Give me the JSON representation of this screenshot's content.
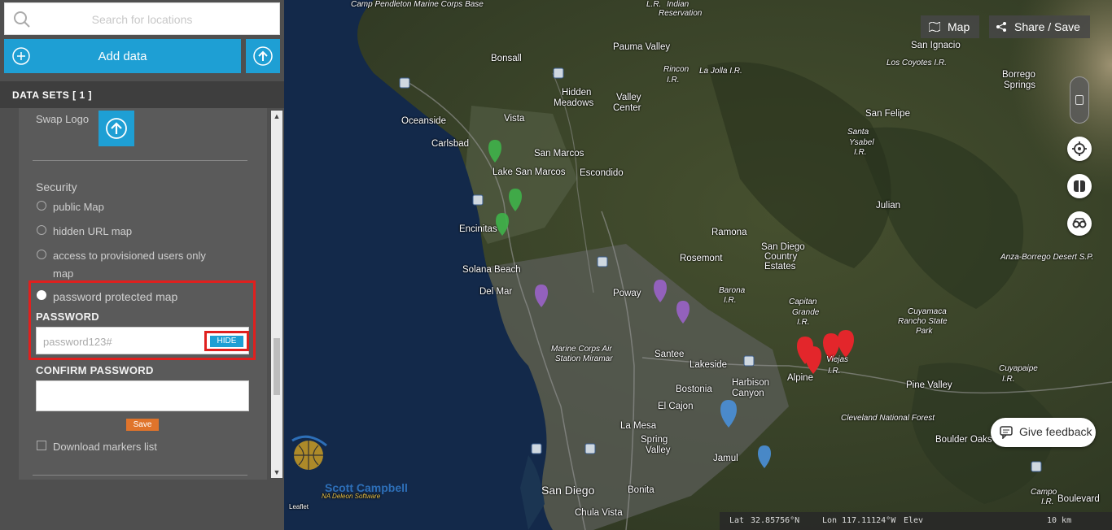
{
  "sidebar": {
    "search_placeholder": "Search for locations",
    "add_data_label": "Add data",
    "datasets_header": "DATA SETS   [ 1 ]",
    "swap_logo_label": "Swap Logo",
    "security_label": "Security",
    "options": {
      "public": "public Map",
      "hidden": "hidden URL map",
      "provisioned": "access to provisioned users only",
      "provisioned_2": "map",
      "password": "password protected map"
    },
    "password_label": "PASSWORD",
    "password_value": "password123#",
    "hide_label": "HIDE",
    "confirm_label": "CONFIRM PASSWORD",
    "confirm_value": "",
    "save_label": "Save",
    "download_label": "Download markers list",
    "colors": {
      "accent": "#1e9fd4",
      "highlight": "#e0201e",
      "save": "#e0742b"
    }
  },
  "map": {
    "map_button": "Map",
    "share_button": "Share / Save",
    "feedback_button": "Give feedback",
    "logo_text": "Scott Campbell",
    "logo_sub": "NA Deleon Software",
    "logo_small": "Leaflet",
    "coords": {
      "lat_label": "Lat",
      "lat": "32.85756°N",
      "lon_label": "Lon",
      "lon": "117.11124°W",
      "elev_label": "Elev"
    },
    "scale": "10 km",
    "places": [
      {
        "name": "Camp Pendleton Marine Corps Base",
        "style": "i"
      },
      {
        "name": "Indian",
        "style": "i"
      },
      {
        "name": "Reservation",
        "style": "i"
      },
      {
        "name": "L.R.",
        "style": "i"
      },
      {
        "name": "Pauma Valley",
        "style": ""
      },
      {
        "name": "Bonsall",
        "style": ""
      },
      {
        "name": "Rincon",
        "style": "i"
      },
      {
        "name": "I.R.",
        "style": "i"
      },
      {
        "name": "La Jolla I.R.",
        "style": "i"
      },
      {
        "name": "San Ignacio",
        "style": ""
      },
      {
        "name": "Los Coyotes I.R.",
        "style": "i"
      },
      {
        "name": "Hidden",
        "style": ""
      },
      {
        "name": "Meadows",
        "style": ""
      },
      {
        "name": "Valley",
        "style": ""
      },
      {
        "name": "Center",
        "style": ""
      },
      {
        "name": "Borrego",
        "style": ""
      },
      {
        "name": "Springs",
        "style": ""
      },
      {
        "name": "Oceanside",
        "style": ""
      },
      {
        "name": "Vista",
        "style": ""
      },
      {
        "name": "San Felipe",
        "style": ""
      },
      {
        "name": "Carlsbad",
        "style": ""
      },
      {
        "name": "San Marcos",
        "style": ""
      },
      {
        "name": "Santa",
        "style": "i"
      },
      {
        "name": "Ysabel",
        "style": "i"
      },
      {
        "name": "I.R.",
        "style": "i"
      },
      {
        "name": "Lake San Marcos",
        "style": ""
      },
      {
        "name": "Escondido",
        "style": ""
      },
      {
        "name": "Julian",
        "style": ""
      },
      {
        "name": "Encinitas",
        "style": ""
      },
      {
        "name": "Ramona",
        "style": ""
      },
      {
        "name": "San Diego",
        "style": ""
      },
      {
        "name": "Country",
        "style": ""
      },
      {
        "name": "Estates",
        "style": ""
      },
      {
        "name": "Anza-Borrego Desert S.P.",
        "style": "i"
      },
      {
        "name": "Rosemont",
        "style": ""
      },
      {
        "name": "Solana Beach",
        "style": ""
      },
      {
        "name": "Poway",
        "style": ""
      },
      {
        "name": "Del Mar",
        "style": ""
      },
      {
        "name": "Barona",
        "style": "i"
      },
      {
        "name": "I.R.",
        "style": "i"
      },
      {
        "name": "Cuyamaca",
        "style": "i"
      },
      {
        "name": "Rancho State",
        "style": "i"
      },
      {
        "name": "Park",
        "style": "i"
      },
      {
        "name": "Capitan",
        "style": "i"
      },
      {
        "name": "Grande",
        "style": "i"
      },
      {
        "name": "I.R.",
        "style": "i"
      },
      {
        "name": "Marine Corps Air",
        "style": "i"
      },
      {
        "name": "Station Miramar",
        "style": "i"
      },
      {
        "name": "Santee",
        "style": ""
      },
      {
        "name": "Lakeside",
        "style": ""
      },
      {
        "name": "Viejas",
        "style": "i"
      },
      {
        "name": "I.R.",
        "style": "i"
      },
      {
        "name": "Alpine",
        "style": ""
      },
      {
        "name": "Pine Valley",
        "style": ""
      },
      {
        "name": "Cuyapaipe",
        "style": "i"
      },
      {
        "name": "I.R.",
        "style": "i"
      },
      {
        "name": "Harbison",
        "style": ""
      },
      {
        "name": "Canyon",
        "style": ""
      },
      {
        "name": "Bostonia",
        "style": ""
      },
      {
        "name": "El Cajon",
        "style": ""
      },
      {
        "name": "Cleveland National Forest",
        "style": "i"
      },
      {
        "name": "La Mesa",
        "style": ""
      },
      {
        "name": "Boulder Oaks",
        "style": ""
      },
      {
        "name": "Spring",
        "style": ""
      },
      {
        "name": "Valley",
        "style": ""
      },
      {
        "name": "Jamul",
        "style": ""
      },
      {
        "name": "San Diego",
        "style": "big"
      },
      {
        "name": "Bonita",
        "style": ""
      },
      {
        "name": "Chula Vista",
        "style": ""
      },
      {
        "name": "Campo",
        "style": "i"
      },
      {
        "name": "I.R.",
        "style": "i"
      },
      {
        "name": "Boulevard",
        "style": ""
      }
    ]
  }
}
